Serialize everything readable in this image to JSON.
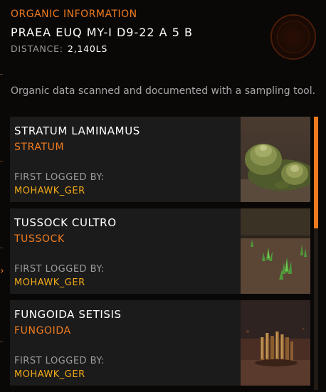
{
  "header": {
    "section_title": "ORGANIC INFORMATION",
    "body_name": "PRAEA EUQ MY-I D9-22 A 5 B",
    "distance_label": "DISTANCE:",
    "distance_value": "2,140LS"
  },
  "description": "Organic data scanned and documented with a sampling tool.",
  "organics": [
    {
      "name": "STRATUM LAMINAMUS",
      "genus": "STRATUM",
      "first_logged_label": "FIRST LOGGED BY:",
      "commander": "MOHAWK_GER",
      "thumbnail": "stratum-image"
    },
    {
      "name": "TUSSOCK CULTRO",
      "genus": "TUSSOCK",
      "first_logged_label": "FIRST LOGGED BY:",
      "commander": "MOHAWK_GER",
      "thumbnail": "tussock-image"
    },
    {
      "name": "FUNGOIDA SETISIS",
      "genus": "FUNGOIDA",
      "first_logged_label": "FIRST LOGGED BY:",
      "commander": "MOHAWK_GER",
      "thumbnail": "fungoida-image"
    }
  ],
  "colors": {
    "accent": "#f07b1e",
    "commander": "#f0a818",
    "card_bg": "#1b1b1b",
    "background": "#0a0807"
  },
  "scroll": {
    "position_fraction": 0.0,
    "visible_fraction": 0.41
  }
}
